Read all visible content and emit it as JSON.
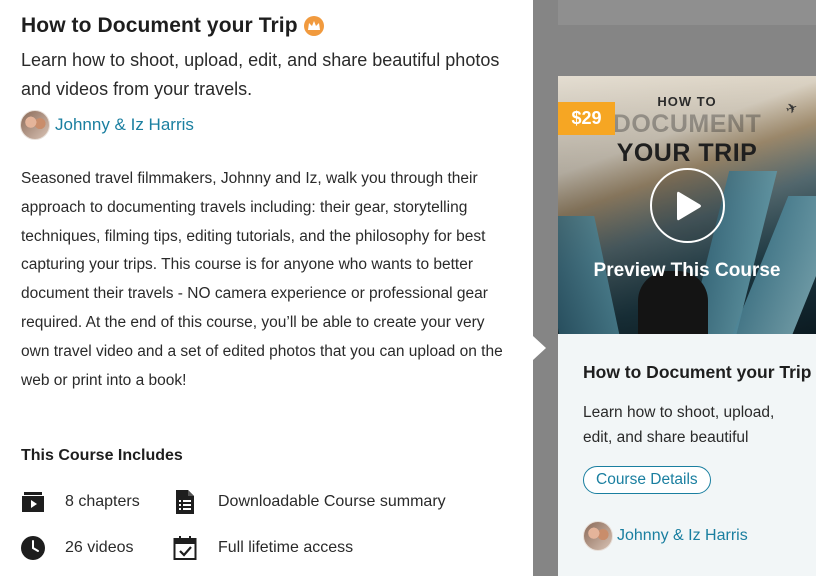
{
  "course": {
    "title": "How to Document your Trip",
    "subtitle": "Learn how to shoot, upload, edit, and share beautiful photos and videos from your travels.",
    "author": "Johnny & Iz Harris",
    "description": "Seasoned travel filmmakers, Johnny and Iz, walk you through their approach to documenting travels including: their gear, storytelling techniques, filming tips, editing tutorials, and the philosophy for best capturing your trips. This course is for anyone who wants to better document their travels - NO camera experience or professional gear required. At the end of this course, you’ll be able to create your very own travel video and a set of edited photos that you can upload on the web or print into a book!"
  },
  "includes": {
    "heading": "This Course Includes",
    "items": [
      {
        "label": "8 chapters",
        "icon": "video-chapters-icon"
      },
      {
        "label": "Downloadable Course summary",
        "icon": "document-icon"
      },
      {
        "label": "26 videos",
        "icon": "clock-icon"
      },
      {
        "label": "Full lifetime access",
        "icon": "calendar-check-icon"
      }
    ]
  },
  "card": {
    "price": "$29",
    "poster_line1": "HOW TO",
    "poster_line2": "DOCUMENT",
    "poster_line3": "YOUR TRIP",
    "preview_label": "Preview This Course",
    "title": "How to Document your Trip",
    "subtitle": "Learn how to shoot, upload, edit, and share beautiful photos and videos from your travels.",
    "details_button": "Course Details",
    "author": "Johnny & Iz Harris"
  },
  "colors": {
    "accent_link": "#1a7fa0",
    "price_badge": "#f6a623",
    "crown_badge": "#f19a3e",
    "overlay": "#858585",
    "card_body": "#f2f6f7"
  }
}
